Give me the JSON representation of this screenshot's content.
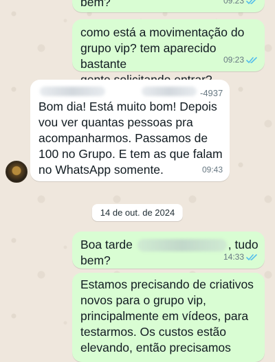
{
  "messages": {
    "m0": {
      "text": "bem?",
      "time": "09:23"
    },
    "m1": {
      "text": "como está a movimentação do\ngrupo vip? tem aparecido bastante\ngente solicitando entrar?",
      "time": "09:23"
    },
    "m2": {
      "sender_phone": "-4937",
      "text": "Bom dia! Está muito bom! Depois\nvou ver quantas pessoas pra\nacompanharmos. Passamos de\n100 no Grupo. E tem as que falam\nno WhatsApp somente.",
      "time": "09:43"
    },
    "date_separator": "14 de out. de 2024",
    "m3": {
      "text_before": "Boa tarde",
      "text_after": ", tudo",
      "line2": "bem?",
      "time": "14:33"
    },
    "m4": {
      "text": "Estamos precisando de criativos\nnovos para o grupo vip,\nprincipalmente em vídeos, para\ntestarmos. Os custos estão\nelevando, então precisamos"
    }
  },
  "colors": {
    "outgoing_bubble": "#d9fdd3",
    "incoming_bubble": "#ffffff",
    "read_ticks": "#53bdeb",
    "background": "#efe7dd"
  },
  "icons": {
    "read_receipt": "double-check-icon",
    "contact_avatar": "avatar"
  }
}
